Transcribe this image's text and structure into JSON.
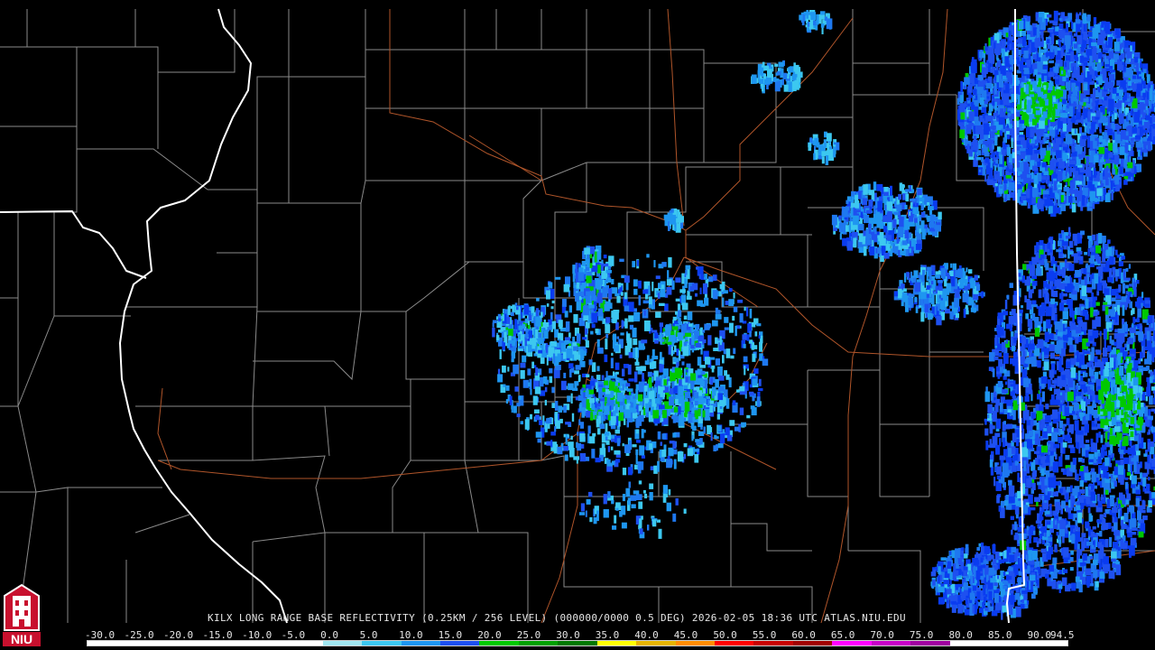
{
  "caption": "KILX LONG RANGE BASE REFLECTIVITY (0.25KM / 256 LEVEL) (000000/0000 0.5 DEG) 2026-02-05 18:36 UTC  ATLAS.NIU.EDU",
  "legend": {
    "ticks": [
      "-30.0",
      "-25.0",
      "-20.0",
      "-15.0",
      "-10.0",
      "-5.0",
      "0.0",
      "5.0",
      "10.0",
      "15.0",
      "20.0",
      "25.0",
      "30.0",
      "35.0",
      "40.0",
      "45.0",
      "50.0",
      "55.0",
      "60.0",
      "65.0",
      "70.0",
      "75.0",
      "80.0",
      "85.0",
      "90.0",
      "94.5"
    ],
    "colors": [
      "#ffffff",
      "#ffffff",
      "#ffffff",
      "#ffffff",
      "#ffffff",
      "#ffffff",
      "#a0e6f0",
      "#3cc8f0",
      "#1e96f0",
      "#1e50f0",
      "#00c800",
      "#00a000",
      "#007800",
      "#ffff00",
      "#e6b400",
      "#ff8c00",
      "#ff0000",
      "#c80000",
      "#a00000",
      "#ff00ff",
      "#c800c8",
      "#a000a0",
      "#ffffff",
      "#ffffff",
      "#ffffff"
    ]
  },
  "logo": {
    "text": "NIU",
    "color": "#c8102e"
  },
  "map": {
    "background": "#000000",
    "county_line_color": "#8a8a8a",
    "state_line_color": "#ffffff",
    "highway_color": "#b0552a"
  }
}
